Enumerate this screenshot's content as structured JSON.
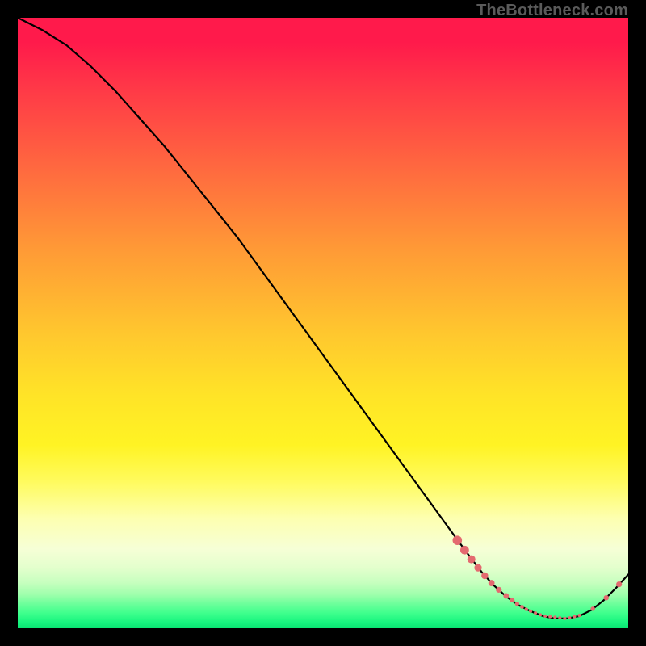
{
  "watermark": "TheBottleneck.com",
  "colors": {
    "marker": "#e46a6f",
    "curve": "#000000",
    "background": "#000000"
  },
  "chart_data": {
    "type": "line",
    "title": "",
    "xlabel": "",
    "ylabel": "",
    "xlim": [
      0,
      100
    ],
    "ylim": [
      0,
      100
    ],
    "grid": false,
    "legend": false,
    "series": [
      {
        "name": "bottleneck-curve",
        "x": [
          0,
          4,
          8,
          12,
          16,
          20,
          24,
          28,
          32,
          36,
          40,
          44,
          48,
          52,
          56,
          60,
          64,
          68,
          72,
          74,
          76,
          78,
          80,
          82,
          84,
          86,
          88,
          90,
          92,
          94,
          96,
          98,
          100
        ],
        "y": [
          100,
          98,
          95.5,
          92,
          88,
          83.5,
          79,
          74,
          69,
          64,
          58.5,
          53,
          47.5,
          42,
          36.5,
          31,
          25.5,
          20,
          14.5,
          11.8,
          9.2,
          7.0,
          5.2,
          3.8,
          2.8,
          2.0,
          1.6,
          1.6,
          2.0,
          3.0,
          4.6,
          6.6,
          8.8
        ]
      }
    ],
    "markers": [
      {
        "x": 72.0,
        "y": 14.4,
        "r": 5.8
      },
      {
        "x": 73.2,
        "y": 12.8,
        "r": 5.4
      },
      {
        "x": 74.3,
        "y": 11.3,
        "r": 5.0
      },
      {
        "x": 75.4,
        "y": 9.9,
        "r": 4.6
      },
      {
        "x": 76.5,
        "y": 8.6,
        "r": 4.2
      },
      {
        "x": 77.6,
        "y": 7.4,
        "r": 3.9
      },
      {
        "x": 78.8,
        "y": 6.3,
        "r": 3.6
      },
      {
        "x": 80.0,
        "y": 5.3,
        "r": 3.4
      },
      {
        "x": 81.0,
        "y": 4.6,
        "r": 2.9
      },
      {
        "x": 81.8,
        "y": 4.0,
        "r": 2.6
      },
      {
        "x": 82.6,
        "y": 3.5,
        "r": 2.4
      },
      {
        "x": 83.3,
        "y": 3.1,
        "r": 2.2
      },
      {
        "x": 84.0,
        "y": 2.8,
        "r": 2.1
      },
      {
        "x": 84.8,
        "y": 2.5,
        "r": 2.0
      },
      {
        "x": 85.6,
        "y": 2.2,
        "r": 2.0
      },
      {
        "x": 86.4,
        "y": 2.0,
        "r": 2.0
      },
      {
        "x": 87.2,
        "y": 1.9,
        "r": 2.0
      },
      {
        "x": 88.0,
        "y": 1.8,
        "r": 2.0
      },
      {
        "x": 88.8,
        "y": 1.7,
        "r": 2.0
      },
      {
        "x": 89.6,
        "y": 1.6,
        "r": 2.0
      },
      {
        "x": 90.4,
        "y": 1.7,
        "r": 2.0
      },
      {
        "x": 91.2,
        "y": 1.9,
        "r": 2.0
      },
      {
        "x": 92.0,
        "y": 2.1,
        "r": 2.0
      },
      {
        "x": 94.2,
        "y": 3.2,
        "r": 2.7
      },
      {
        "x": 96.4,
        "y": 5.0,
        "r": 3.2
      },
      {
        "x": 98.5,
        "y": 7.2,
        "r": 3.6
      }
    ]
  }
}
